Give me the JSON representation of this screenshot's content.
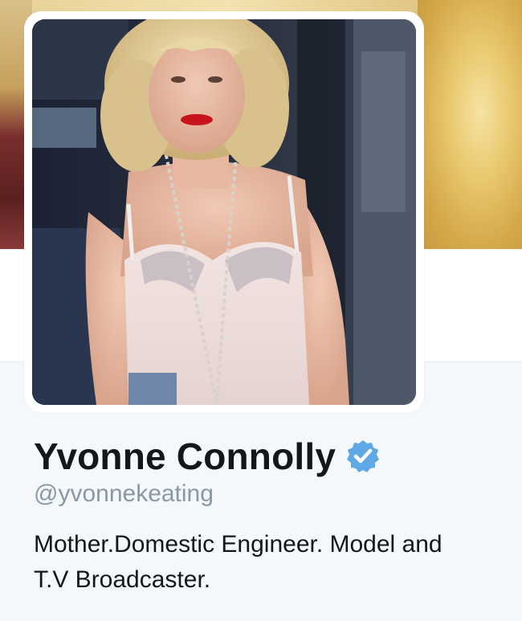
{
  "profile": {
    "display_name": "Yvonne Connolly",
    "verified": true,
    "handle": "@yvonnekeating",
    "bio_lines": [
      "Mother.Domestic Engineer. Model and",
      "T.V Broadcaster."
    ]
  },
  "icons": {
    "verified": "verified-badge-icon"
  },
  "colors": {
    "background": "#f5f8fa",
    "name_text": "#14171a",
    "handle_text": "#8899a6",
    "verified_blue": "#1da1f2"
  }
}
